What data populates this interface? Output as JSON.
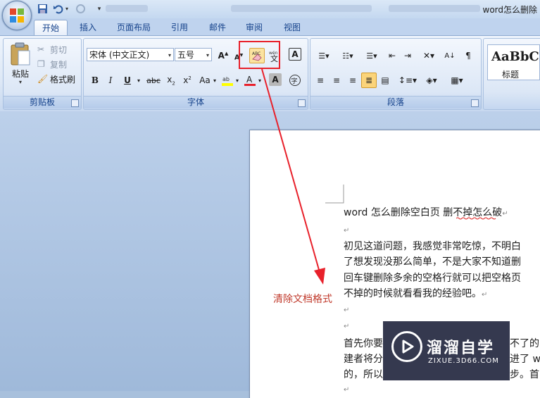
{
  "window": {
    "title": "word怎么删除"
  },
  "tabs": [
    "开始",
    "插入",
    "页面布局",
    "引用",
    "邮件",
    "审阅",
    "视图"
  ],
  "clipboard": {
    "paste": "粘贴",
    "cut": "剪切",
    "copy": "复制",
    "format_painter": "格式刷",
    "group": "剪贴板"
  },
  "font": {
    "name": "宋体 (中文正文)",
    "size": "五号",
    "group": "字体",
    "change_case": "Aa",
    "highlight_color": "#ffff00",
    "font_color": "#e8212b",
    "char_border": "A",
    "char_shading": "A",
    "pinyin": "文"
  },
  "paragraph": {
    "group": "段落"
  },
  "styles": {
    "preview": "AaBbC",
    "name": "标题"
  },
  "document": {
    "lines": [
      "word 怎么删除空白页  删不掉怎么破",
      "初见这道问题，我感觉非常吃惊，不明白",
      "了想发现没那么简单，不是大家不知道删",
      "回车键删除多余的空格行就可以把空格页",
      "不掉的时候就看看我的经验吧。",
      "首先你要",
      "建者将分",
      "的，所以"
    ],
    "frag_a": "不了的",
    "frag_b": "进了 w",
    "frag_c": "步。首",
    "para_mark": "↵"
  },
  "annotation": {
    "label": "清除文档格式",
    "color": "#c0392b"
  },
  "watermark": {
    "title": "溜溜自学",
    "url": "ZIXUE.3D66.COM"
  }
}
